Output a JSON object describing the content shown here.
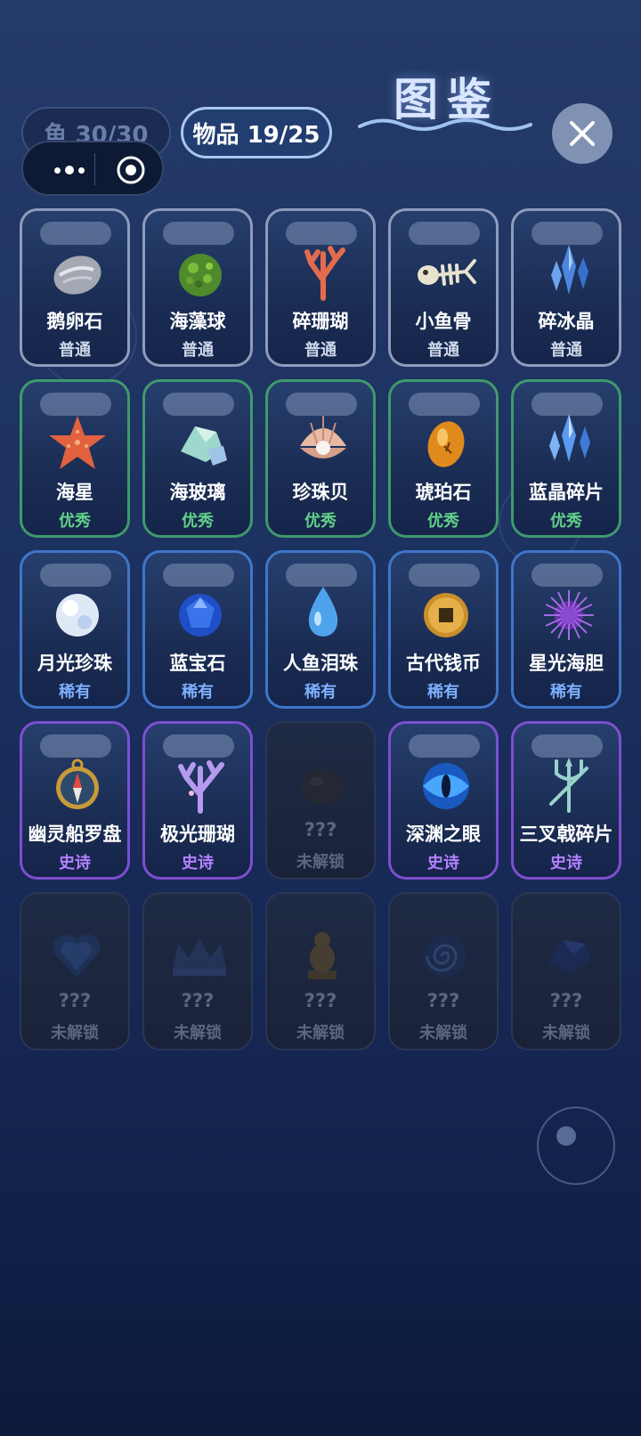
{
  "title": "图鉴",
  "tabs": {
    "fish": "鱼 30/30",
    "items": "物品 19/25"
  },
  "items": [
    {
      "name": "鹅卵石",
      "rarity": "普通",
      "tier": "common",
      "icon": "pebble-icon"
    },
    {
      "name": "海藻球",
      "rarity": "普通",
      "tier": "common",
      "icon": "algae-ball-icon"
    },
    {
      "name": "碎珊瑚",
      "rarity": "普通",
      "tier": "common",
      "icon": "coral-icon"
    },
    {
      "name": "小鱼骨",
      "rarity": "普通",
      "tier": "common",
      "icon": "fish-bone-icon"
    },
    {
      "name": "碎冰晶",
      "rarity": "普通",
      "tier": "common",
      "icon": "ice-crystal-icon"
    },
    {
      "name": "海星",
      "rarity": "优秀",
      "tier": "excellent",
      "icon": "starfish-icon"
    },
    {
      "name": "海玻璃",
      "rarity": "优秀",
      "tier": "excellent",
      "icon": "sea-glass-icon"
    },
    {
      "name": "珍珠贝",
      "rarity": "优秀",
      "tier": "excellent",
      "icon": "pearl-shell-icon"
    },
    {
      "name": "琥珀石",
      "rarity": "优秀",
      "tier": "excellent",
      "icon": "amber-icon"
    },
    {
      "name": "蓝晶碎片",
      "rarity": "优秀",
      "tier": "excellent",
      "icon": "blue-crystal-icon"
    },
    {
      "name": "月光珍珠",
      "rarity": "稀有",
      "tier": "rare",
      "icon": "moon-pearl-icon"
    },
    {
      "name": "蓝宝石",
      "rarity": "稀有",
      "tier": "rare",
      "icon": "sapphire-icon"
    },
    {
      "name": "人鱼泪珠",
      "rarity": "稀有",
      "tier": "rare",
      "icon": "teardrop-icon"
    },
    {
      "name": "古代钱币",
      "rarity": "稀有",
      "tier": "rare",
      "icon": "ancient-coin-icon"
    },
    {
      "name": "星光海胆",
      "rarity": "稀有",
      "tier": "rare",
      "icon": "sea-urchin-icon"
    },
    {
      "name": "幽灵船罗盘",
      "rarity": "史诗",
      "tier": "epic",
      "icon": "compass-icon"
    },
    {
      "name": "极光珊瑚",
      "rarity": "史诗",
      "tier": "epic",
      "icon": "aurora-coral-icon"
    },
    {
      "name": "???",
      "rarity": "未解锁",
      "tier": "locked",
      "icon": "locked-rock-icon"
    },
    {
      "name": "深渊之眼",
      "rarity": "史诗",
      "tier": "epic",
      "icon": "abyss-eye-icon"
    },
    {
      "name": "三叉戟碎片",
      "rarity": "史诗",
      "tier": "epic",
      "icon": "trident-icon"
    },
    {
      "name": "???",
      "rarity": "未解锁",
      "tier": "locked",
      "icon": "locked-heart-icon"
    },
    {
      "name": "???",
      "rarity": "未解锁",
      "tier": "locked",
      "icon": "locked-crown-icon"
    },
    {
      "name": "???",
      "rarity": "未解锁",
      "tier": "locked",
      "icon": "locked-statue-icon"
    },
    {
      "name": "???",
      "rarity": "未解锁",
      "tier": "locked",
      "icon": "locked-vortex-icon"
    },
    {
      "name": "???",
      "rarity": "未解锁",
      "tier": "locked",
      "icon": "locked-gem-icon"
    }
  ]
}
